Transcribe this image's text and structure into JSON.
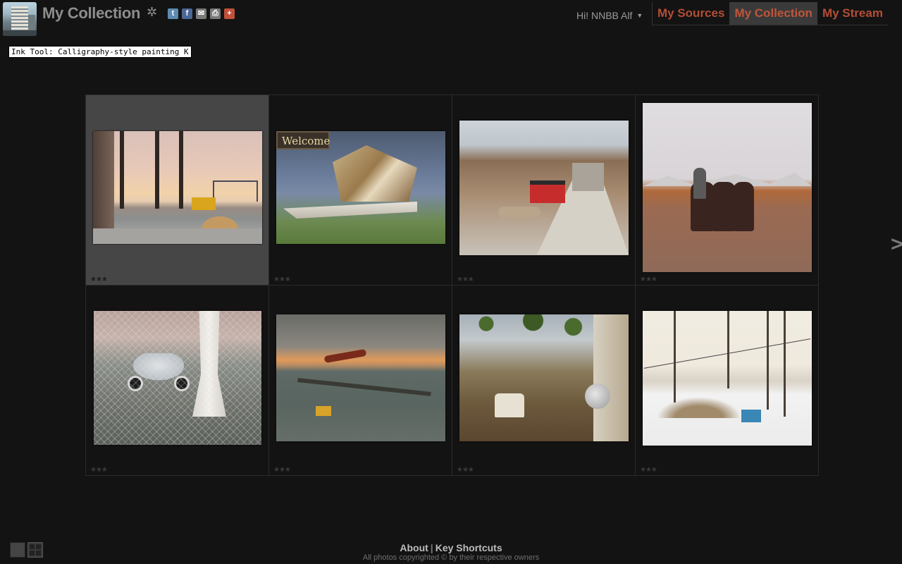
{
  "header": {
    "title": "My Collection",
    "user_greeting": "Hi! NNBB Alf",
    "share_icons": [
      "twitter-icon",
      "facebook-icon",
      "email-icon",
      "print-icon",
      "plus-icon"
    ]
  },
  "nav": {
    "tabs": [
      {
        "label": "My Sources",
        "active": false
      },
      {
        "label": "My Collection",
        "active": true
      },
      {
        "label": "My Stream",
        "active": false
      }
    ]
  },
  "tooltip": {
    "text": "Ink Tool: Calligraphy-style painting  K"
  },
  "grid": {
    "selected_index": 0,
    "items": [
      {
        "subject": "construction site with bridge at sunset",
        "rating": "★★★"
      },
      {
        "subject": "Welcome sign with wrecked furniture",
        "rating": "★★★"
      },
      {
        "subject": "red snowcat on mountain road",
        "rating": "★★★"
      },
      {
        "subject": "rider with horses on dirt road",
        "rating": "★★★"
      },
      {
        "subject": "VW Beetle behind chain-link fence and white tree",
        "rating": "★★★"
      },
      {
        "subject": "industrial lake with smoke at dusk",
        "rating": "★★★"
      },
      {
        "subject": "small car in village street with satellite dish",
        "rating": "★★★"
      },
      {
        "subject": "snowy field with bare trees",
        "rating": "★★★"
      }
    ],
    "next_arrow": ">"
  },
  "photo2_sign": "Welcome",
  "footer": {
    "about": "About",
    "separator": "|",
    "shortcuts": "Key Shortcuts",
    "copyright": "All photos copyrighted © by their respective owners"
  },
  "colors": {
    "background": "#131313",
    "nav_accent": "#b44e35",
    "selected_cell": "#464646"
  }
}
